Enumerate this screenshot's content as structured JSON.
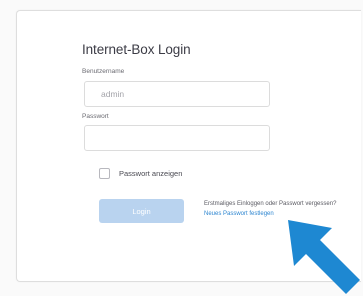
{
  "login": {
    "title": "Internet-Box Login",
    "username_label": "Benutzername",
    "username_value": "admin",
    "password_label": "Passwort",
    "password_value": "",
    "show_password_label": "Passwort anzeigen",
    "show_password_checked": false,
    "login_button_label": "Login",
    "first_login_text": "Erstmaliges Einloggen oder Passwort vergessen?",
    "new_password_link": "Neues Passwort festlegen"
  },
  "colors": {
    "accent_arrow": "#1e88d2",
    "link": "#2e86d0",
    "login_button_disabled": "#b9d3ef"
  },
  "annotations": {
    "arrow_icon": "arrow-up-left-icon"
  }
}
